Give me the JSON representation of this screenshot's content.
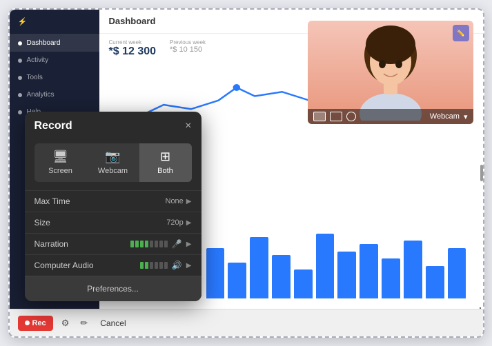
{
  "app": {
    "title": "Dashboard"
  },
  "sidebar": {
    "items": [
      {
        "label": "Dashboard",
        "active": true
      },
      {
        "label": "Activity",
        "active": false
      },
      {
        "label": "Tools",
        "active": false
      },
      {
        "label": "Analytics",
        "active": false
      },
      {
        "label": "Help",
        "active": false
      }
    ]
  },
  "dashboard": {
    "title": "Dashboard",
    "current_week_label": "Current week",
    "previous_week_label": "Previous week",
    "current_value": "*$ 12 300",
    "previous_value": "*$ 10 150"
  },
  "record_dialog": {
    "title": "Record",
    "close_label": "×",
    "modes": [
      {
        "label": "Screen",
        "active": false
      },
      {
        "label": "Webcam",
        "active": false
      },
      {
        "label": "Both",
        "active": true
      }
    ],
    "settings": [
      {
        "label": "Max Time",
        "value": "None"
      },
      {
        "label": "Size",
        "value": "720p"
      },
      {
        "label": "Narration",
        "value": ""
      },
      {
        "label": "Computer Audio",
        "value": ""
      }
    ],
    "preferences_label": "Preferences..."
  },
  "webcam": {
    "label": "Webcam",
    "dropdown_icon": "▾"
  },
  "bottom_bar": {
    "rec_label": "Rec",
    "cancel_label": "Cancel"
  },
  "move_icon": "✥"
}
